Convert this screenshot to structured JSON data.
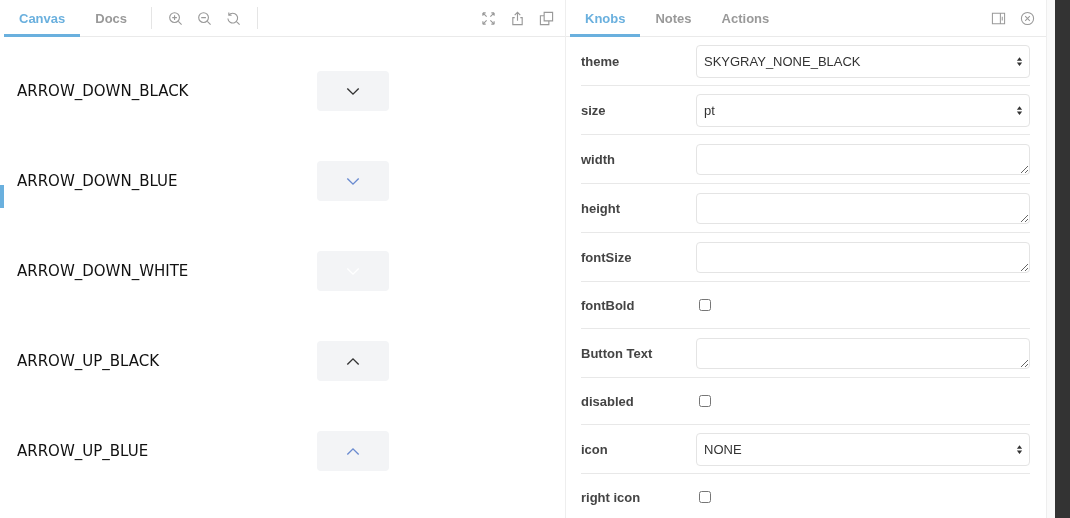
{
  "preview": {
    "tabs": [
      {
        "label": "Canvas",
        "selected": true
      },
      {
        "label": "Docs",
        "selected": false
      }
    ],
    "stories": [
      {
        "label": "ARROW_DOWN_BLACK",
        "kind": "down",
        "color": "#333333"
      },
      {
        "label": "ARROW_DOWN_BLUE",
        "kind": "down",
        "color": "#6a8bd0"
      },
      {
        "label": "ARROW_DOWN_WHITE",
        "kind": "down",
        "color": "#ffffff"
      },
      {
        "label": "ARROW_UP_BLACK",
        "kind": "up",
        "color": "#333333"
      },
      {
        "label": "ARROW_UP_BLUE",
        "kind": "up",
        "color": "#6a8bd0"
      }
    ]
  },
  "addons": {
    "tabs": [
      {
        "label": "Knobs",
        "selected": true
      },
      {
        "label": "Notes",
        "selected": false
      },
      {
        "label": "Actions",
        "selected": false
      }
    ],
    "knobs": [
      {
        "label": "theme",
        "kind": "select",
        "value": "SKYGRAY_NONE_BLACK"
      },
      {
        "label": "size",
        "kind": "select",
        "value": "pt"
      },
      {
        "label": "width",
        "kind": "text"
      },
      {
        "label": "height",
        "kind": "text"
      },
      {
        "label": "fontSize",
        "kind": "text"
      },
      {
        "label": "fontBold",
        "kind": "checkbox",
        "checked": false
      },
      {
        "label": "Button Text",
        "kind": "text"
      },
      {
        "label": "disabled",
        "kind": "checkbox",
        "checked": false
      },
      {
        "label": "icon",
        "kind": "select",
        "value": "NONE"
      },
      {
        "label": "right icon",
        "kind": "checkbox",
        "checked": false
      }
    ]
  }
}
